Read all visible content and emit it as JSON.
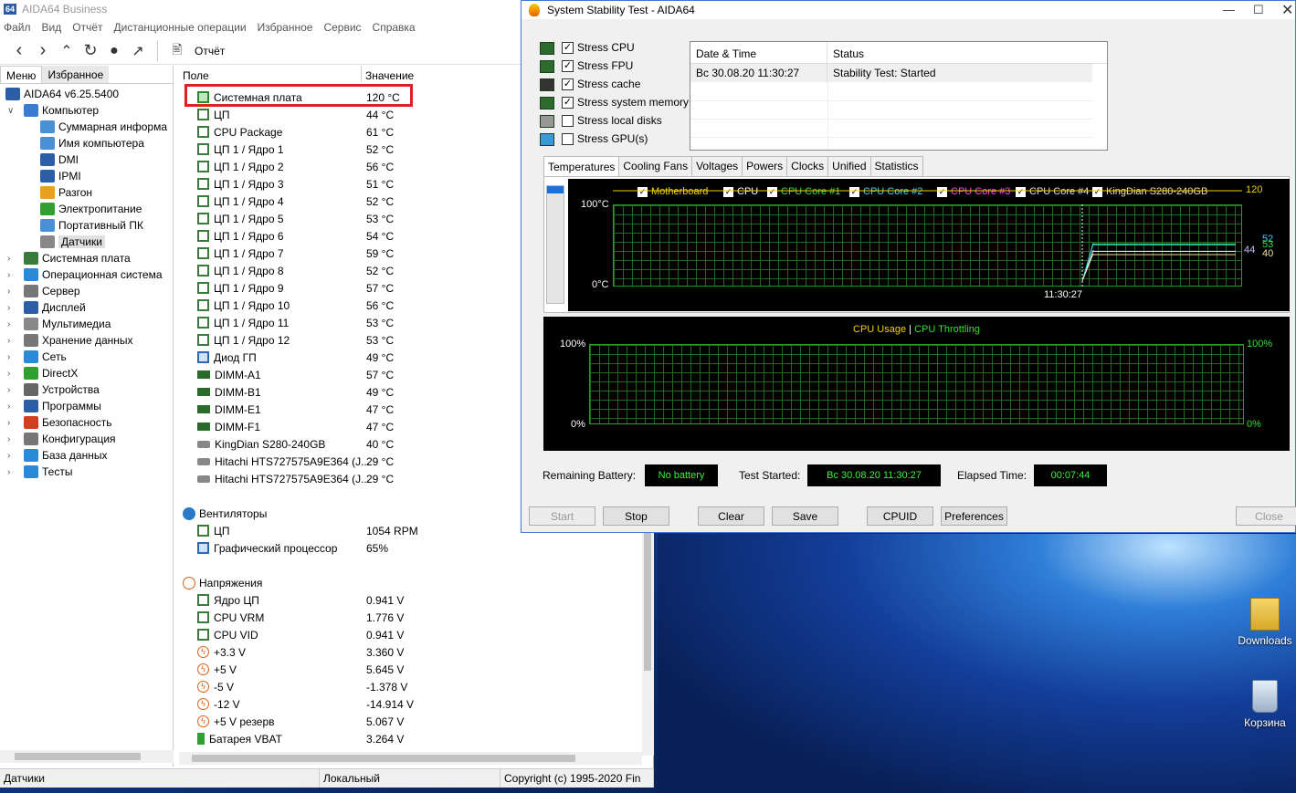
{
  "desktop": {
    "icons": [
      {
        "label": "Downloads"
      },
      {
        "label": "Корзина"
      }
    ]
  },
  "main": {
    "title": "AIDA64 Business",
    "logo": "64",
    "menu": [
      "Файл",
      "Вид",
      "Отчёт",
      "Дистанционные операции",
      "Избранное",
      "Сервис",
      "Справка"
    ],
    "toolbar": {
      "report_label": "Отчёт"
    },
    "left_tabs": [
      "Меню",
      "Избранное"
    ],
    "tree_root": "AIDA64 v6.25.5400",
    "tree": [
      {
        "label": "Компьютер",
        "level": 0,
        "expanded": true
      },
      {
        "label": "Суммарная информа",
        "level": 1
      },
      {
        "label": "Имя компьютера",
        "level": 1
      },
      {
        "label": "DMI",
        "level": 1
      },
      {
        "label": "IPMI",
        "level": 1
      },
      {
        "label": "Разгон",
        "level": 1
      },
      {
        "label": "Электропитание",
        "level": 1
      },
      {
        "label": "Портативный ПК",
        "level": 1
      },
      {
        "label": "Датчики",
        "level": 1,
        "selected": true
      },
      {
        "label": "Системная плата",
        "level": 0
      },
      {
        "label": "Операционная система",
        "level": 0
      },
      {
        "label": "Сервер",
        "level": 0
      },
      {
        "label": "Дисплей",
        "level": 0
      },
      {
        "label": "Мультимедиа",
        "level": 0
      },
      {
        "label": "Хранение данных",
        "level": 0
      },
      {
        "label": "Сеть",
        "level": 0
      },
      {
        "label": "DirectX",
        "level": 0
      },
      {
        "label": "Устройства",
        "level": 0
      },
      {
        "label": "Программы",
        "level": 0
      },
      {
        "label": "Безопасность",
        "level": 0
      },
      {
        "label": "Конфигурация",
        "level": 0
      },
      {
        "label": "База данных",
        "level": 0
      },
      {
        "label": "Тесты",
        "level": 0
      }
    ],
    "columns": {
      "field": "Поле",
      "value": "Значение"
    },
    "temps": [
      {
        "name": "Системная плата",
        "value": "120 °C",
        "icon": "board"
      },
      {
        "name": "ЦП",
        "value": "44 °C",
        "icon": "chip"
      },
      {
        "name": "CPU Package",
        "value": "61 °C",
        "icon": "chip"
      },
      {
        "name": "ЦП 1 / Ядро 1",
        "value": "52 °C",
        "icon": "chip"
      },
      {
        "name": "ЦП 1 / Ядро 2",
        "value": "56 °C",
        "icon": "chip"
      },
      {
        "name": "ЦП 1 / Ядро 3",
        "value": "51 °C",
        "icon": "chip"
      },
      {
        "name": "ЦП 1 / Ядро 4",
        "value": "52 °C",
        "icon": "chip"
      },
      {
        "name": "ЦП 1 / Ядро 5",
        "value": "53 °C",
        "icon": "chip"
      },
      {
        "name": "ЦП 1 / Ядро 6",
        "value": "54 °C",
        "icon": "chip"
      },
      {
        "name": "ЦП 1 / Ядро 7",
        "value": "59 °C",
        "icon": "chip"
      },
      {
        "name": "ЦП 1 / Ядро 8",
        "value": "52 °C",
        "icon": "chip"
      },
      {
        "name": "ЦП 1 / Ядро 9",
        "value": "57 °C",
        "icon": "chip"
      },
      {
        "name": "ЦП 1 / Ядро 10",
        "value": "56 °C",
        "icon": "chip"
      },
      {
        "name": "ЦП 1 / Ядро 11",
        "value": "53 °C",
        "icon": "chip"
      },
      {
        "name": "ЦП 1 / Ядро 12",
        "value": "53 °C",
        "icon": "chip"
      },
      {
        "name": "Диод ГП",
        "value": "49 °C",
        "icon": "gpu"
      },
      {
        "name": "DIMM-A1",
        "value": "57 °C",
        "icon": "ram"
      },
      {
        "name": "DIMM-B1",
        "value": "49 °C",
        "icon": "ram"
      },
      {
        "name": "DIMM-E1",
        "value": "47 °C",
        "icon": "ram"
      },
      {
        "name": "DIMM-F1",
        "value": "47 °C",
        "icon": "ram"
      },
      {
        "name": "KingDian S280-240GB",
        "value": "40 °C",
        "icon": "hdd"
      },
      {
        "name": "Hitachi HTS727575A9E364 (J...",
        "value": "29 °C",
        "icon": "hdd"
      },
      {
        "name": "Hitachi HTS727575A9E364 (J...",
        "value": "29 °C",
        "icon": "hdd"
      }
    ],
    "fans_header": "Вентиляторы",
    "fans": [
      {
        "name": "ЦП",
        "value": "1054 RPM",
        "icon": "chip"
      },
      {
        "name": "Графический процессор",
        "value": "65%",
        "icon": "gpu"
      }
    ],
    "volts_header": "Напряжения",
    "volts": [
      {
        "name": "Ядро ЦП",
        "value": "0.941 V",
        "icon": "chip"
      },
      {
        "name": "CPU VRM",
        "value": "1.776 V",
        "icon": "chip"
      },
      {
        "name": "CPU VID",
        "value": "0.941 V",
        "icon": "chip"
      },
      {
        "name": "+3.3 V",
        "value": "3.360 V",
        "icon": "volt"
      },
      {
        "name": "+5 V",
        "value": "5.645 V",
        "icon": "volt"
      },
      {
        "name": "-5 V",
        "value": "-1.378 V",
        "icon": "volt"
      },
      {
        "name": "-12 V",
        "value": "-14.914 V",
        "icon": "volt"
      },
      {
        "name": "+5 V резерв",
        "value": "5.067 V",
        "icon": "volt"
      },
      {
        "name": "Батарея VBAT",
        "value": "3.264 V",
        "icon": "battery"
      }
    ],
    "status": [
      "Датчики",
      "Локальный",
      "Copyright (c) 1995-2020 Fin"
    ]
  },
  "stability": {
    "title": "System Stability Test - AIDA64",
    "stress": [
      {
        "label": "Stress CPU",
        "checked": true
      },
      {
        "label": "Stress FPU",
        "checked": true
      },
      {
        "label": "Stress cache",
        "checked": true
      },
      {
        "label": "Stress system memory",
        "checked": true
      },
      {
        "label": "Stress local disks",
        "checked": false
      },
      {
        "label": "Stress GPU(s)",
        "checked": false
      }
    ],
    "log": {
      "headers": [
        "Date & Time",
        "Status"
      ],
      "rows": [
        [
          "Вс 30.08.20 11:30:27",
          "Stability Test: Started"
        ]
      ]
    },
    "tabs": [
      "Temperatures",
      "Cooling Fans",
      "Voltages",
      "Powers",
      "Clocks",
      "Unified",
      "Statistics"
    ],
    "temp_chart": {
      "legend": [
        {
          "label": "Motherboard",
          "color": "#f0d000"
        },
        {
          "label": "CPU",
          "color": "#ffffff"
        },
        {
          "label": "CPU Core #1",
          "color": "#30e030"
        },
        {
          "label": "CPU Core #2",
          "color": "#40d0ff"
        },
        {
          "label": "CPU Core #3",
          "color": "#ff40ff"
        },
        {
          "label": "CPU Core #4",
          "color": "#e0e0e0"
        },
        {
          "label": "KingDian S280-240GB",
          "color": "#f0e0a0"
        }
      ],
      "y_top": "100°C",
      "y_bottom": "0°C",
      "x_label": "11:30:27",
      "right_vals": [
        {
          "text": "120",
          "color": "#f0d000"
        },
        {
          "text": "52",
          "color": "#40d0ff"
        },
        {
          "text": "53",
          "color": "#30e030"
        },
        {
          "text": "44",
          "color": "#c0c0ff"
        },
        {
          "text": "40",
          "color": "#f0e0a0"
        }
      ]
    },
    "usage_chart": {
      "title_a": "CPU Usage",
      "sep": "|",
      "title_b": "CPU Throttling",
      "left_top": "100%",
      "left_bottom": "0%",
      "right_top": "100%",
      "right_bottom": "0%"
    },
    "chart_data": {
      "type": "line",
      "x": [
        "11:30:27"
      ],
      "series": [
        {
          "name": "Motherboard",
          "values": [
            120
          ]
        },
        {
          "name": "CPU",
          "values": [
            44
          ]
        },
        {
          "name": "CPU Core #1",
          "values": [
            53
          ]
        },
        {
          "name": "CPU Core #2",
          "values": [
            52
          ]
        },
        {
          "name": "KingDian S280-240GB",
          "values": [
            40
          ]
        }
      ],
      "ylim": [
        0,
        100
      ]
    },
    "info": {
      "battery_label": "Remaining Battery:",
      "battery": "No battery",
      "started_label": "Test Started:",
      "started": "Вс 30.08.20 11:30:27",
      "elapsed_label": "Elapsed Time:",
      "elapsed": "00:07:44"
    },
    "buttons": {
      "start": "Start",
      "stop": "Stop",
      "clear": "Clear",
      "save": "Save",
      "cpuid": "CPUID",
      "prefs": "Preferences",
      "close": "Close"
    }
  }
}
